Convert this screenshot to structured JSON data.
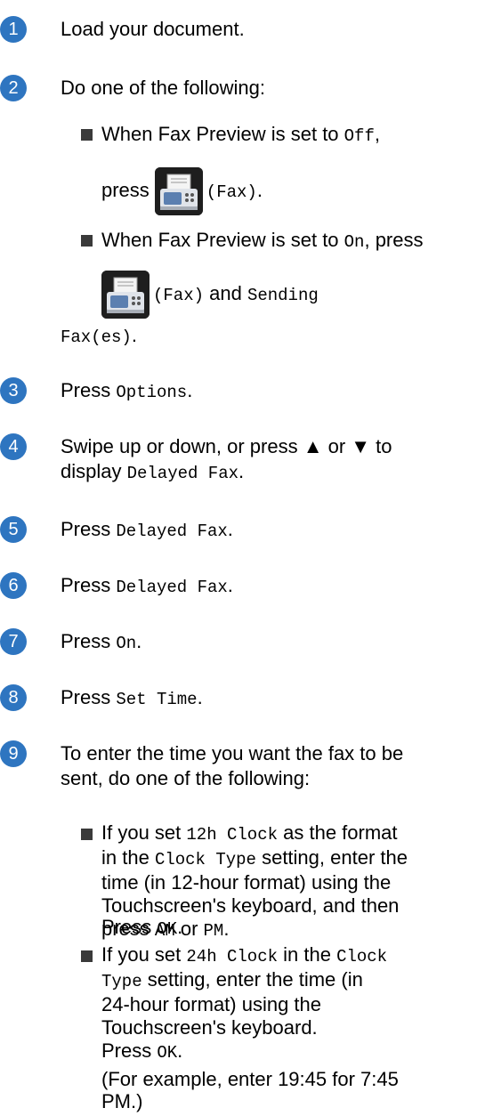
{
  "steps": [
    {
      "num": "1",
      "text": "Load your document."
    },
    {
      "num": "2",
      "text": "Do one of the following:"
    },
    {
      "num": "3",
      "pre": "Press ",
      "code": "Options",
      "post": "."
    },
    {
      "num": "4",
      "line1": "Swipe up or down, or press ▲ or ▼ to",
      "pre2": "display ",
      "code": "Delayed Fax",
      "post": "."
    },
    {
      "num": "5",
      "pre": "Press ",
      "code": "Delayed Fax",
      "post": "."
    },
    {
      "num": "6",
      "pre": "Press ",
      "code": "Delayed Fax",
      "post": "."
    },
    {
      "num": "7",
      "pre": "Press ",
      "code": "On",
      "post": "."
    },
    {
      "num": "8",
      "pre": "Press ",
      "code": "Set Time",
      "post": "."
    },
    {
      "num": "9",
      "line1": "To enter the time you want the fax to be",
      "line2": "sent, do one of the following:"
    }
  ],
  "step2": {
    "b1_pre": "When Fax Preview is set to ",
    "b1_code": "Off",
    "b1_post": ",",
    "b1_press": "press",
    "fax_label": "(Fax)",
    "b1_end": ".",
    "b2_pre": "When Fax Preview is set to ",
    "b2_code": "On",
    "b2_post": ", press",
    "b2_fax": "(Fax)",
    "b2_and": " and ",
    "b2_code2a": "Sending",
    "b2_code2b": "Fax(es)",
    "b2_end": "."
  },
  "step9": {
    "a_l1_pre": "If you set ",
    "a_l1_code": "12h Clock",
    "a_l1_post": " as the format",
    "a_l2_pre": "in the ",
    "a_l2_code": "Clock Type",
    "a_l2_post": " setting, enter the",
    "a_l3": "time (in 12-hour format) using the",
    "a_l4": "Touchscreen's keyboard, and then",
    "a_l5_pre": "press ",
    "a_l5_code1": "AM",
    "a_l5_or": " or ",
    "a_l5_code2": "PM",
    "a_l5_post": ".",
    "a_ok_pre": "Press ",
    "a_ok_code": "OK",
    "a_ok_post": ".",
    "b_l1_pre": "If you set ",
    "b_l1_code": "24h Clock",
    "b_l1_mid": " in the ",
    "b_l1_code2": "Clock",
    "b_l2_code": "Type",
    "b_l2_post": " setting, enter the time (in",
    "b_l3": "24-hour format) using the",
    "b_l4": "Touchscreen's keyboard.",
    "b_ok_pre": "Press ",
    "b_ok_code": "OK",
    "b_ok_post": ".",
    "example_l1": "(For example, enter 19:45 for 7:45",
    "example_l2": "PM.)"
  }
}
